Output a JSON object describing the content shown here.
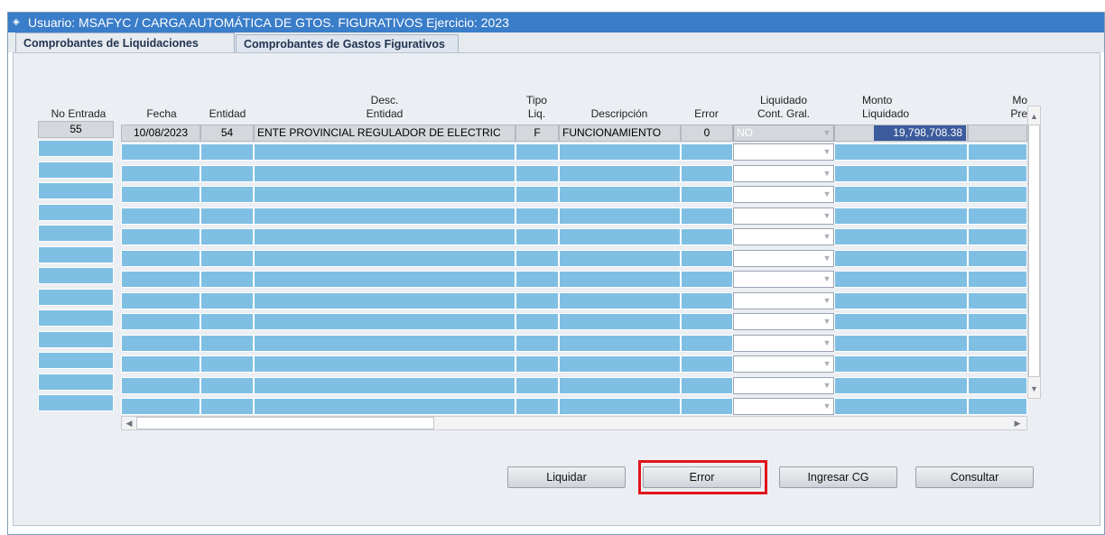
{
  "title": {
    "text": "Usuario: MSAFYC   /   CARGA AUTOMÁTICA DE GTOS. FIGURATIVOS  Ejercicio: 2023"
  },
  "tabs": [
    {
      "label": "Comprobantes de Liquidaciones",
      "active": true
    },
    {
      "label": "Comprobantes de Gastos Figurativos",
      "active": false
    }
  ],
  "table": {
    "headers": {
      "no_entrada": "No Entrada",
      "fecha": "Fecha",
      "entidad": "Entidad",
      "desc_entidad_1": "Desc.",
      "desc_entidad_2": "Entidad",
      "tipo_liq_1": "Tipo",
      "tipo_liq_2": "Liq.",
      "descripcion": "Descripción",
      "error": "Error",
      "liquidado_1": "Liquidado",
      "liquidado_2": "Cont. Gral.",
      "monto_1": "Monto",
      "monto_2": "Liquidado",
      "mo_1": "Mo",
      "mo_2": "Pre"
    },
    "rows": [
      {
        "no_entrada": "55",
        "fecha": "10/08/2023",
        "entidad": "54",
        "desc_entidad": "ENTE PROVINCIAL REGULADOR DE ELECTRIC",
        "tipo_liq": "F",
        "descripcion": "FUNCIONAMIENTO",
        "error": "0",
        "liquidado": "NO",
        "monto": "19,798,708.38"
      }
    ]
  },
  "buttons": {
    "liquidar": "Liquidar",
    "error": "Error",
    "ingresar_cg": "Ingresar CG",
    "consultar": "Consultar"
  },
  "colors": {
    "titlebar": "#3a7dc9",
    "cell": "#7fbfe3",
    "highlight": "#e0151b"
  }
}
